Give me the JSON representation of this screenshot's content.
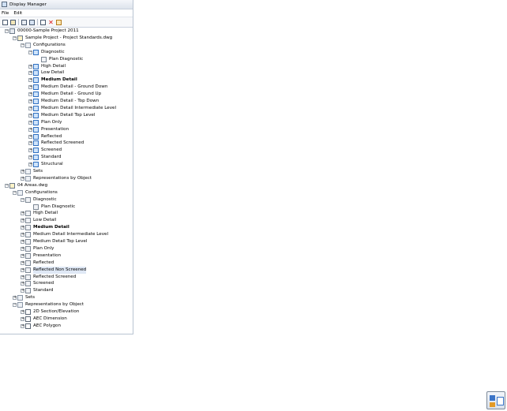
{
  "window": {
    "title": "Display Manager",
    "menu": [
      "File",
      "Edit"
    ],
    "toolbar": [
      "new-icon",
      "open-icon",
      "copy-icon",
      "paste-icon",
      "properties-icon",
      "delete-icon",
      "purge-icon"
    ]
  },
  "tree": [
    {
      "label": "00000-Sample Project 2011",
      "level": 0,
      "exp": "-",
      "icon": "project"
    },
    {
      "label": "Sample Project - Project Standards.dwg",
      "level": 1,
      "exp": "-",
      "icon": "drawing"
    },
    {
      "label": "Configurations",
      "level": 2,
      "exp": "-",
      "icon": "folder"
    },
    {
      "label": "Diagnostic",
      "level": 3,
      "exp": "-",
      "icon": "config"
    },
    {
      "label": "Plan Diagnostic",
      "level": 4,
      "exp": "",
      "icon": "configgray"
    },
    {
      "label": "High Detail",
      "level": 3,
      "exp": "+",
      "icon": "config"
    },
    {
      "label": "Low Detail",
      "level": 3,
      "exp": "+",
      "icon": "config"
    },
    {
      "label": "Medium Detail",
      "level": 3,
      "exp": "+",
      "icon": "config",
      "bold": true
    },
    {
      "label": "Medium Detail - Ground Down",
      "level": 3,
      "exp": "+",
      "icon": "config"
    },
    {
      "label": "Medium Detail - Ground Up",
      "level": 3,
      "exp": "+",
      "icon": "config"
    },
    {
      "label": "Medium Detail - Top Down",
      "level": 3,
      "exp": "+",
      "icon": "config"
    },
    {
      "label": "Medium Detail Intermediate Level",
      "level": 3,
      "exp": "+",
      "icon": "config"
    },
    {
      "label": "Medium Detail Top Level",
      "level": 3,
      "exp": "+",
      "icon": "config"
    },
    {
      "label": "Plan Only",
      "level": 3,
      "exp": "+",
      "icon": "config"
    },
    {
      "label": "Presentation",
      "level": 3,
      "exp": "+",
      "icon": "config"
    },
    {
      "label": "Reflected",
      "level": 3,
      "exp": "+",
      "icon": "config"
    },
    {
      "label": "Reflected Screened",
      "level": 3,
      "exp": "+",
      "icon": "config"
    },
    {
      "label": "Screened",
      "level": 3,
      "exp": "+",
      "icon": "config"
    },
    {
      "label": "Standard",
      "level": 3,
      "exp": "+",
      "icon": "config"
    },
    {
      "label": "Structural",
      "level": 3,
      "exp": "+",
      "icon": "config"
    },
    {
      "label": "Sets",
      "level": 2,
      "exp": "+",
      "icon": "folder"
    },
    {
      "label": "Representations by Object",
      "level": 2,
      "exp": "+",
      "icon": "folder"
    },
    {
      "label": "04 Areas.dwg",
      "level": 0,
      "exp": "-",
      "icon": "drawing"
    },
    {
      "label": "Configurations",
      "level": 1,
      "exp": "-",
      "icon": "folder"
    },
    {
      "label": "Diagnostic",
      "level": 2,
      "exp": "-",
      "icon": "configgray"
    },
    {
      "label": "Plan Diagnostic",
      "level": 3,
      "exp": "",
      "icon": "configgray"
    },
    {
      "label": "High Detail",
      "level": 2,
      "exp": "+",
      "icon": "configgray"
    },
    {
      "label": "Low Detail",
      "level": 2,
      "exp": "+",
      "icon": "configgray"
    },
    {
      "label": "Medium Detail",
      "level": 2,
      "exp": "+",
      "icon": "configgray",
      "bold": true
    },
    {
      "label": "Medium Detail Intermediate Level",
      "level": 2,
      "exp": "+",
      "icon": "configgray"
    },
    {
      "label": "Medium Detail Top Level",
      "level": 2,
      "exp": "+",
      "icon": "configgray"
    },
    {
      "label": "Plan Only",
      "level": 2,
      "exp": "+",
      "icon": "configgray"
    },
    {
      "label": "Presentation",
      "level": 2,
      "exp": "+",
      "icon": "configgray"
    },
    {
      "label": "Reflected",
      "level": 2,
      "exp": "+",
      "icon": "configgray"
    },
    {
      "label": "Reflected Non Screened",
      "level": 2,
      "exp": "+",
      "icon": "configgray",
      "highlight": true
    },
    {
      "label": "Reflected Screened",
      "level": 2,
      "exp": "+",
      "icon": "configgray"
    },
    {
      "label": "Screened",
      "level": 2,
      "exp": "+",
      "icon": "configgray"
    },
    {
      "label": "Standard",
      "level": 2,
      "exp": "+",
      "icon": "configgray"
    },
    {
      "label": "Sets",
      "level": 1,
      "exp": "+",
      "icon": "folder"
    },
    {
      "label": "Representations by Object",
      "level": 1,
      "exp": "-",
      "icon": "folder"
    },
    {
      "label": "2D Section/Elevation",
      "level": 2,
      "exp": "+",
      "icon": "rep"
    },
    {
      "label": "AEC Dimension",
      "level": 2,
      "exp": "+",
      "icon": "rep"
    },
    {
      "label": "AEC Polygon",
      "level": 2,
      "exp": "+",
      "icon": "rep"
    }
  ],
  "tray": {
    "icon": "display-manager-icon"
  }
}
